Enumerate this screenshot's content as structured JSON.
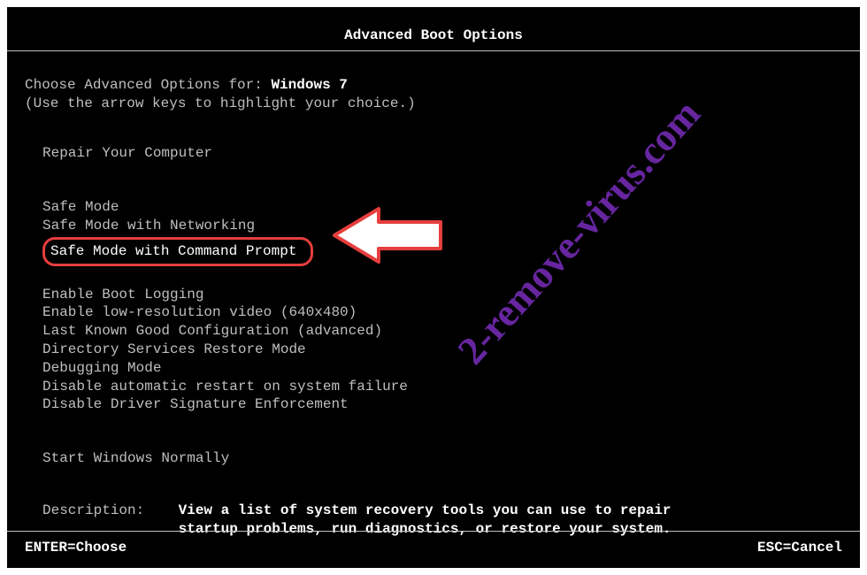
{
  "title": "Advanced Boot Options",
  "prompt_prefix": "Choose Advanced Options for: ",
  "os_name": "Windows 7",
  "instruction": "(Use the arrow keys to highlight your choice.)",
  "options": {
    "group1": [
      "Repair Your Computer"
    ],
    "group2": [
      "Safe Mode",
      "Safe Mode with Networking",
      "Safe Mode with Command Prompt"
    ],
    "group3": [
      "Enable Boot Logging",
      "Enable low-resolution video (640x480)",
      "Last Known Good Configuration (advanced)",
      "Directory Services Restore Mode",
      "Debugging Mode",
      "Disable automatic restart on system failure",
      "Disable Driver Signature Enforcement"
    ],
    "group4": [
      "Start Windows Normally"
    ]
  },
  "highlighted_option": "Safe Mode with Command Prompt",
  "description": {
    "label": "Description:    ",
    "line1": "View a list of system recovery tools you can use to repair",
    "line2": "startup problems, run diagnostics, or restore your system."
  },
  "footer": {
    "enter": "ENTER=Choose",
    "esc": "ESC=Cancel"
  },
  "watermark": "2-remove-virus.com"
}
